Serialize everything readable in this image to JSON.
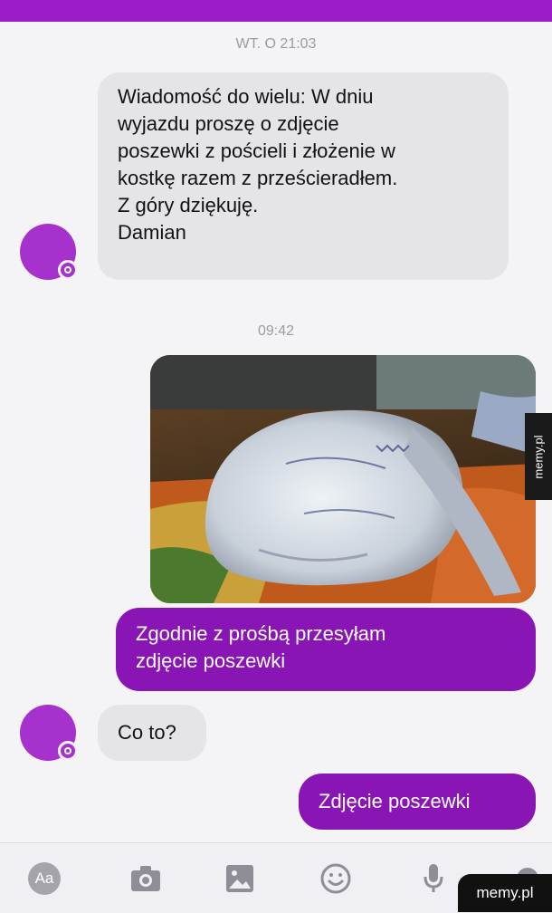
{
  "header": {
    "accent_color": "#9b1bc9"
  },
  "messages": {
    "time_1": "WT. O 21:03",
    "incoming_1": {
      "lines": [
        "Wiadomość do wielu: W dniu",
        "wyjazdu proszę o zdjęcie",
        "poszewki z pościeli i złożenie w",
        "kostkę razem z prześcieradłem.",
        "Z góry dziękuję.",
        "Damian"
      ]
    },
    "time_2": "09:42",
    "photo": {
      "subject": "photo of a crumpled pillowcase on a bed"
    },
    "outgoing_1": {
      "lines": [
        "Zgodnie z prośbą przesyłam",
        "zdjęcie poszewki"
      ]
    },
    "incoming_2": "Co to?",
    "outgoing_2": "Zdjęcie poszewki"
  },
  "composer": {
    "aa_label": "Aa",
    "icons": [
      "camera-icon",
      "gallery-icon",
      "emoji-icon",
      "microphone-icon",
      "more-icon"
    ]
  },
  "watermarks": {
    "side": "memy.pl",
    "corner": "memy.pl"
  },
  "colors": {
    "outgoing_bubble": "#8a15b5",
    "incoming_bubble": "#e5e4e8",
    "avatar": "#a631cc"
  }
}
